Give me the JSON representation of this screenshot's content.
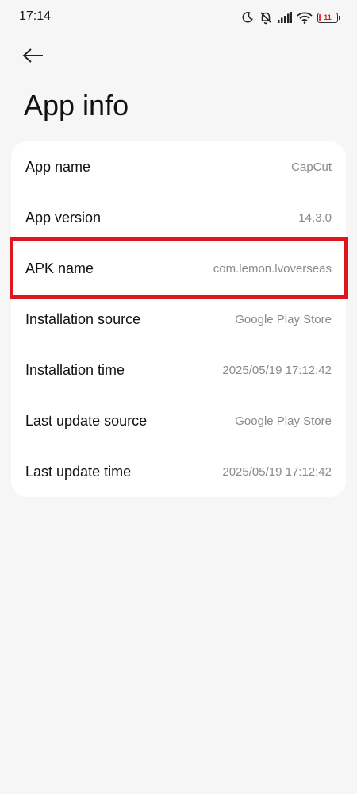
{
  "status_bar": {
    "time": "17:14",
    "battery_level": "11",
    "battery_color": "#e53935"
  },
  "header": {
    "back_icon": "arrow-left-icon",
    "title": "App info"
  },
  "info_rows": [
    {
      "label": "App name",
      "value": "CapCut"
    },
    {
      "label": "App version",
      "value": "14.3.0"
    },
    {
      "label": "APK name",
      "value": "com.lemon.lvoverseas"
    },
    {
      "label": "Installation source",
      "value": "Google Play Store"
    },
    {
      "label": "Installation time",
      "value": "2025/05/19 17:12:42"
    },
    {
      "label": "Last update source",
      "value": "Google Play Store"
    },
    {
      "label": "Last update time",
      "value": "2025/05/19 17:12:42"
    }
  ],
  "highlight": {
    "target": "APK name",
    "color": "#e0161f"
  }
}
